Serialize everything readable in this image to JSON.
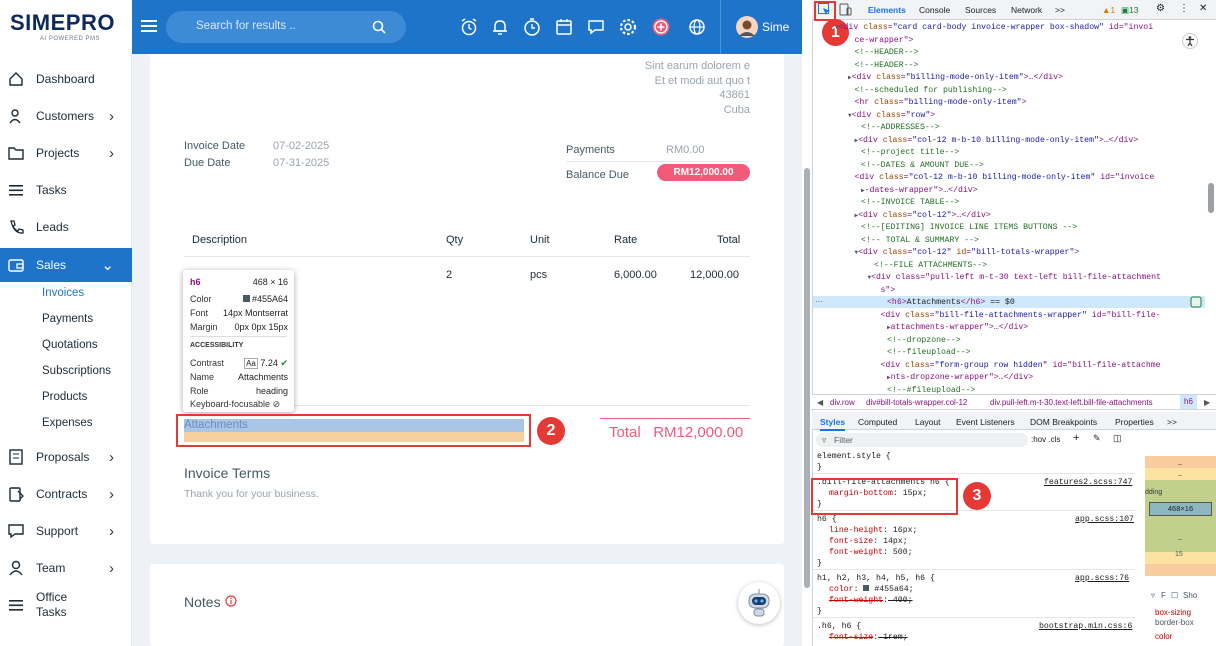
{
  "brand": {
    "name": "SIMEPRO",
    "tagline": "AI POWERED PMS"
  },
  "sidebar": {
    "items": [
      {
        "label": "Dashboard",
        "icon": "home-icon",
        "chevron": false
      },
      {
        "label": "Customers",
        "icon": "users-icon",
        "chevron": true
      },
      {
        "label": "Projects",
        "icon": "folder-icon",
        "chevron": true
      },
      {
        "label": "Tasks",
        "icon": "list-icon",
        "chevron": false
      },
      {
        "label": "Leads",
        "icon": "phone-icon",
        "chevron": false
      },
      {
        "label": "Sales",
        "icon": "wallet-icon",
        "chevron": true,
        "active": true
      },
      {
        "label": "Proposals",
        "icon": "document-icon",
        "chevron": true
      },
      {
        "label": "Contracts",
        "icon": "contract-icon",
        "chevron": true
      },
      {
        "label": "Support",
        "icon": "chat-icon",
        "chevron": true
      },
      {
        "label": "Team",
        "icon": "person-icon",
        "chevron": true
      },
      {
        "label": "Office Tasks",
        "icon": "list-icon",
        "chevron": false
      }
    ],
    "sales_sub": [
      "Invoices",
      "Payments",
      "Quotations",
      "Subscriptions",
      "Products",
      "Expenses"
    ],
    "active_sub": "Invoices"
  },
  "header": {
    "search_placeholder": "Search for results ..",
    "user_name": "Sime",
    "icons": [
      "alarm-clock-icon",
      "bell-icon",
      "timer-icon",
      "calendar-icon",
      "chat-icon",
      "gear-icon",
      "plus-circle-icon",
      "globe-icon"
    ]
  },
  "invoice": {
    "address": [
      "Sint earum dolorem e",
      "Et et modi aut quo t",
      "43861",
      "Cuba"
    ],
    "invoice_date_label": "Invoice Date",
    "invoice_date": "07-02-2025",
    "due_date_label": "Due Date",
    "due_date": "07-31-2025",
    "payments_label": "Payments",
    "payments": "RM0.00",
    "balance_due_label": "Balance Due",
    "balance_due": "RM12,000.00",
    "columns": [
      "Description",
      "Qty",
      "Unit",
      "Rate",
      "Total"
    ],
    "row": {
      "qty": "2",
      "unit": "pcs",
      "rate": "6,000.00",
      "total": "12,000.00"
    },
    "attachments_label": "Attachments",
    "total_label": "Total",
    "total_value": "RM12,000.00",
    "terms_heading": "Invoice Terms",
    "terms_text": "Thank you for your business.",
    "notes_heading": "Notes"
  },
  "tooltip": {
    "tag": "h6",
    "size": "468 × 16",
    "color_label": "Color",
    "color": "#455A64",
    "font_label": "Font",
    "font": "14px Montserrat",
    "margin_label": "Margin",
    "margin": "0px 0px 15px",
    "section": "ACCESSIBILITY",
    "contrast_label": "Contrast",
    "contrast": "7.24",
    "name_label": "Name",
    "name": "Attachments",
    "role_label": "Role",
    "role": "heading",
    "keyboard_label": "Keyboard-focusable"
  },
  "badges": [
    "1",
    "2",
    "3"
  ],
  "devtools": {
    "tabs": [
      "Elements",
      "Console",
      "Sources",
      "Network",
      ">>"
    ],
    "issues": {
      "warn": "1",
      "msgs": "13"
    },
    "dom_lines": [
      {
        "indent": 8,
        "open": true,
        "html": "<div class=\"card card-body invoice-wrapper box-shadow\" id=\"invoi"
      },
      {
        "indent": 11,
        "html": "ce-wrapper\">"
      },
      {
        "indent": 11,
        "html": "<!--HEADER-->",
        "comment": true
      },
      {
        "indent": 11,
        "html": "<!--HEADER-->",
        "comment": true
      },
      {
        "indent": 10,
        "html": "<div class=\"billing-mode-only-item\">…</div>"
      },
      {
        "indent": 11,
        "html": "<!--scheduled for publishing-->",
        "comment": true
      },
      {
        "indent": 11,
        "html": "<hr class=\"billing-mode-only-item\">"
      },
      {
        "indent": 10,
        "open": true,
        "html": "<div class=\"row\">"
      },
      {
        "indent": 12,
        "html": "<!--ADDRESSES-->",
        "comment": true
      },
      {
        "indent": 11,
        "html": "<div class=\"col-12 m-b-10 billing-mode-only-item\">…</div>"
      },
      {
        "indent": 12,
        "html": "<!--project title-->",
        "comment": true
      },
      {
        "indent": 12,
        "html": "<!--DATES & AMOUNT DUE-->",
        "comment": true
      },
      {
        "indent": 11,
        "html": "<div class=\"col-12 m-b-10 billing-mode-only-item\" id=\"invoice"
      },
      {
        "indent": 12,
        "html": "-dates-wrapper\">…</div>"
      },
      {
        "indent": 12,
        "html": "<!--INVOICE TABLE-->",
        "comment": true
      },
      {
        "indent": 11,
        "html": "<div class=\"col-12\">…</div>"
      },
      {
        "indent": 12,
        "html": "<!--[EDITING] INVOICE LINE ITEMS BUTTONS -->",
        "comment": true
      },
      {
        "indent": 12,
        "html": "<!-- TOTAL & SUMMARY -->",
        "comment": true
      },
      {
        "indent": 11,
        "open": true,
        "html": "<div class=\"col-12\" id=\"bill-totals-wrapper\">"
      },
      {
        "indent": 14,
        "html": "<!--FILE ATTACHMENTS-->",
        "comment": true
      },
      {
        "indent": 13,
        "open": true,
        "html": "<div class=\"pull-left m-t-30 text-left bill-file-attachment"
      },
      {
        "indent": 15,
        "html": "s\">"
      },
      {
        "indent": 16,
        "html": "<h6>Attachments</h6> == $0",
        "selected": true
      },
      {
        "indent": 15,
        "html": "<div class=\"bill-file-attachments-wrapper\" id=\"bill-file-"
      },
      {
        "indent": 16,
        "html": "attachments-wrapper\">…</div>"
      },
      {
        "indent": 16,
        "html": "<!--dropzone-->",
        "comment": true
      },
      {
        "indent": 16,
        "html": "<!--fileupload-->",
        "comment": true
      },
      {
        "indent": 15,
        "html": "<div class=\"form-group row hidden\" id=\"bill-file-attachme"
      },
      {
        "indent": 16,
        "html": "nts-dropzone-wrapper\">…</div>"
      },
      {
        "indent": 16,
        "html": "<!--#fileupload-->",
        "comment": true
      }
    ],
    "breadcrumbs": [
      "div.row",
      "div#bill-totals-wrapper.col-12",
      "div.pull-left.m-t-30.text-left.bill-file-attachments",
      "h6"
    ],
    "style_tabs": [
      "Styles",
      "Computed",
      "Layout",
      "Event Listeners",
      "DOM Breakpoints",
      "Properties",
      ">>"
    ],
    "filter_placeholder": "Filter",
    "filter_tools": ":hov .cls",
    "rules": [
      {
        "selector": "element.style {",
        "props": [],
        "src": ""
      },
      {
        "selector": ".bill-file-attachments h6 {",
        "props": [
          "margin-bottom: 15px;"
        ],
        "src": "features2.scss:747"
      },
      {
        "selector": "h6 {",
        "props": [
          "line-height: 16px;",
          "font-size: 14px;",
          "font-weight: 500;"
        ],
        "src": "app.scss:107"
      },
      {
        "selector": "h1, h2, h3, h4, h5, h6 {",
        "props": [
          "color: #455a64;",
          "font-weight: 400;"
        ],
        "src": "app.scss:76"
      },
      {
        "selector": ".h6, h6 {",
        "props": [
          "font-size: 1rem;"
        ],
        "src": "bootstrap.min.css:6"
      }
    ],
    "boxmodel": {
      "padding_label": "dding",
      "content": "468×16",
      "margin_bottom": "15",
      "dash": "–"
    },
    "computed_filter": "Sho",
    "computed_props": [
      "box-sizing",
      "border-box",
      "color"
    ]
  }
}
